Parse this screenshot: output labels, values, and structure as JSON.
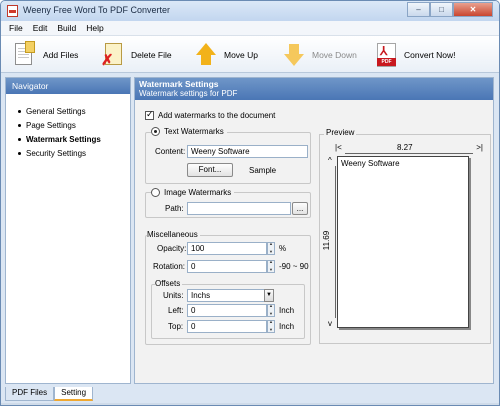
{
  "window": {
    "title": "Weeny Free Word To PDF Converter",
    "controls": {
      "minimize": "–",
      "maximize": "□",
      "close": "✕"
    }
  },
  "menu": [
    "File",
    "Edit",
    "Build",
    "Help"
  ],
  "toolbar": {
    "add_files": "Add Files",
    "delete_file": "Delete File",
    "move_up": "Move Up",
    "move_down": "Move Down",
    "convert_now": "Convert Now!"
  },
  "navigator": {
    "title": "Navigator",
    "items": [
      "General Settings",
      "Page Settings",
      "Watermark Settings",
      "Security Settings"
    ],
    "active_index": 2
  },
  "bottom_tabs": [
    "PDF Files",
    "Setting"
  ],
  "main": {
    "title": "Watermark Settings",
    "subtitle": "Watermark settings for PDF",
    "add_watermarks_label": "Add watermarks to the document",
    "text_watermarks": {
      "label": "Text Watermarks",
      "content_label": "Content:",
      "content_value": "Weeny Software",
      "font_button": "Font...",
      "sample_label": "Sample"
    },
    "image_watermarks": {
      "label": "Image Watermarks",
      "path_label": "Path:",
      "path_value": "",
      "browse_button": "..."
    },
    "misc": {
      "title": "Miscellaneous",
      "opacity_label": "Opacity:",
      "opacity_value": "100",
      "opacity_unit": "%",
      "rotation_label": "Rotation:",
      "rotation_value": "0",
      "rotation_range": "-90 ~ 90"
    },
    "offsets": {
      "title": "Offsets",
      "units_label": "Units:",
      "units_value": "Inchs",
      "left_label": "Left:",
      "left_value": "0",
      "left_unit": "Inch",
      "top_label": "Top:",
      "top_value": "0",
      "top_unit": "Inch"
    },
    "preview": {
      "title": "Preview",
      "ruler_left": "|<",
      "ruler_right": ">|",
      "width_value": "8.27",
      "ruler_top": "^",
      "ruler_bottom": "v",
      "height_value": "11.69",
      "watermark_text": "Weeny Software"
    }
  }
}
